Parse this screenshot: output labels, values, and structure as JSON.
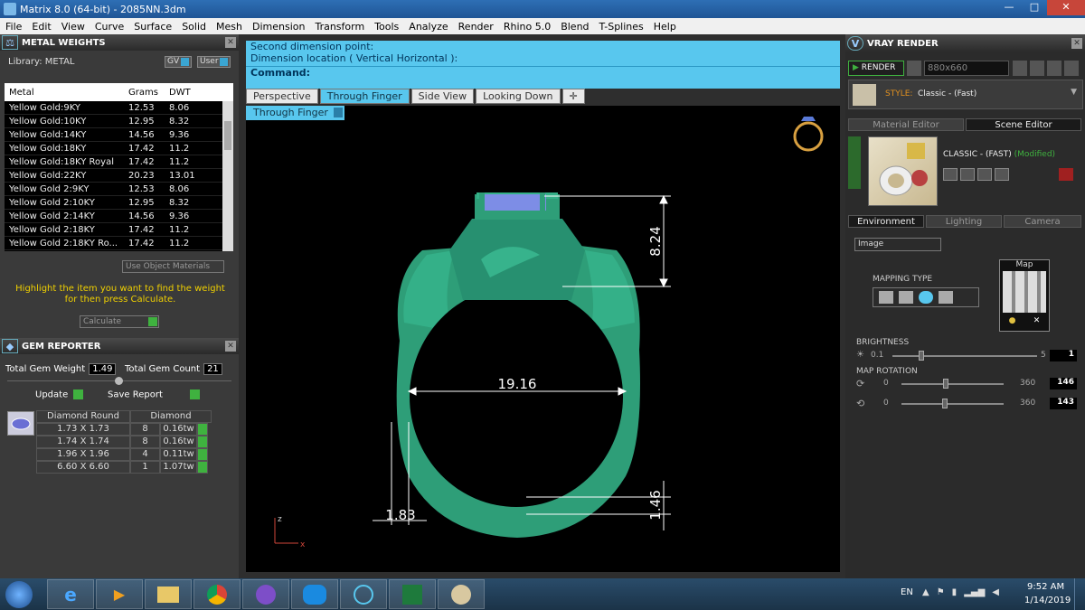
{
  "window": {
    "title": "Matrix 8.0 (64-bit) - 2085NN.3dm",
    "min": "—",
    "max": "□",
    "close": "✕"
  },
  "menu": [
    "File",
    "Edit",
    "View",
    "Curve",
    "Surface",
    "Solid",
    "Mesh",
    "Dimension",
    "Transform",
    "Tools",
    "Analyze",
    "Render",
    "Rhino 5.0",
    "Blend",
    "T-Splines",
    "Help"
  ],
  "metal": {
    "title": "METAL WEIGHTS",
    "library": "Library: METAL",
    "gv": "GV",
    "user": "User",
    "columns": [
      "Metal",
      "Grams",
      "DWT"
    ],
    "rows": [
      [
        "Yellow Gold:9KY",
        "12.53",
        "8.06"
      ],
      [
        "Yellow Gold:10KY",
        "12.95",
        "8.32"
      ],
      [
        "Yellow Gold:14KY",
        "14.56",
        "9.36"
      ],
      [
        "Yellow Gold:18KY",
        "17.42",
        "11.2"
      ],
      [
        "Yellow Gold:18KY Royal",
        "17.42",
        "11.2"
      ],
      [
        "Yellow Gold:22KY",
        "20.23",
        "13.01"
      ],
      [
        "Yellow Gold 2:9KY",
        "12.53",
        "8.06"
      ],
      [
        "Yellow Gold 2:10KY",
        "12.95",
        "8.32"
      ],
      [
        "Yellow Gold 2:14KY",
        "14.56",
        "9.36"
      ],
      [
        "Yellow Gold 2:18KY",
        "17.42",
        "11.2"
      ],
      [
        "Yellow Gold 2:18KY Ro...",
        "17.42",
        "11.2"
      ]
    ],
    "use_object": "Use Object Materials",
    "help": "Highlight the item you want to find the weight for then press Calculate.",
    "calculate": "Calculate"
  },
  "gem": {
    "title": "GEM REPORTER",
    "total_weight_label": "Total Gem Weight",
    "total_weight": "1.49",
    "total_count_label": "Total Gem Count",
    "total_count": "21",
    "update": "Update",
    "save_report": "Save Report",
    "header": [
      "Diamond Round",
      "Diamond"
    ],
    "rows": [
      [
        "1.73 X 1.73",
        "8",
        "0.16tw"
      ],
      [
        "1.74 X 1.74",
        "8",
        "0.16tw"
      ],
      [
        "1.96 X 1.96",
        "4",
        "0.11tw"
      ],
      [
        "6.60 X 6.60",
        "1",
        "1.07tw"
      ]
    ]
  },
  "command": {
    "line1": "Second dimension point:",
    "line2": "Dimension location ( Vertical  Horizontal ):",
    "prompt": "Command:"
  },
  "tabs": [
    "Perspective",
    "Through Finger",
    "Side View",
    "Looking Down"
  ],
  "viewport": {
    "label": "Through Finger",
    "dims": {
      "d1": "8.24",
      "d2": "19.16",
      "d3": "1.83",
      "d4": "1.46"
    },
    "axis_z": "z",
    "axis_x": "x"
  },
  "vray": {
    "title": "VRAY RENDER",
    "render": "RENDER",
    "size": "880x660",
    "style_label": "STYLE:",
    "style": "Classic - (Fast)",
    "tab_material": "Material Editor",
    "tab_scene": "Scene Editor",
    "preset": "CLASSIC - (FAST)",
    "modified": "(Modified)",
    "tab_env": "Environment",
    "tab_light": "Lighting",
    "tab_camera": "Camera",
    "env_select": "Image",
    "mapping": "MAPPING TYPE",
    "map": "Map",
    "brightness": "BRIGHTNESS",
    "b_min": "0.1",
    "b_max": "5",
    "b_val": "1",
    "b_level": 0.18,
    "rotation": "MAP ROTATION",
    "r_min": "0",
    "r_max": "360",
    "r1": "146",
    "r2": "143"
  },
  "taskbar": {
    "lang": "EN",
    "time": "9:52 AM",
    "date": "1/14/2019"
  },
  "colors": {
    "accent": "#58c7ee",
    "ring": "#2e9e78",
    "green_btn": "#3fb23f"
  }
}
